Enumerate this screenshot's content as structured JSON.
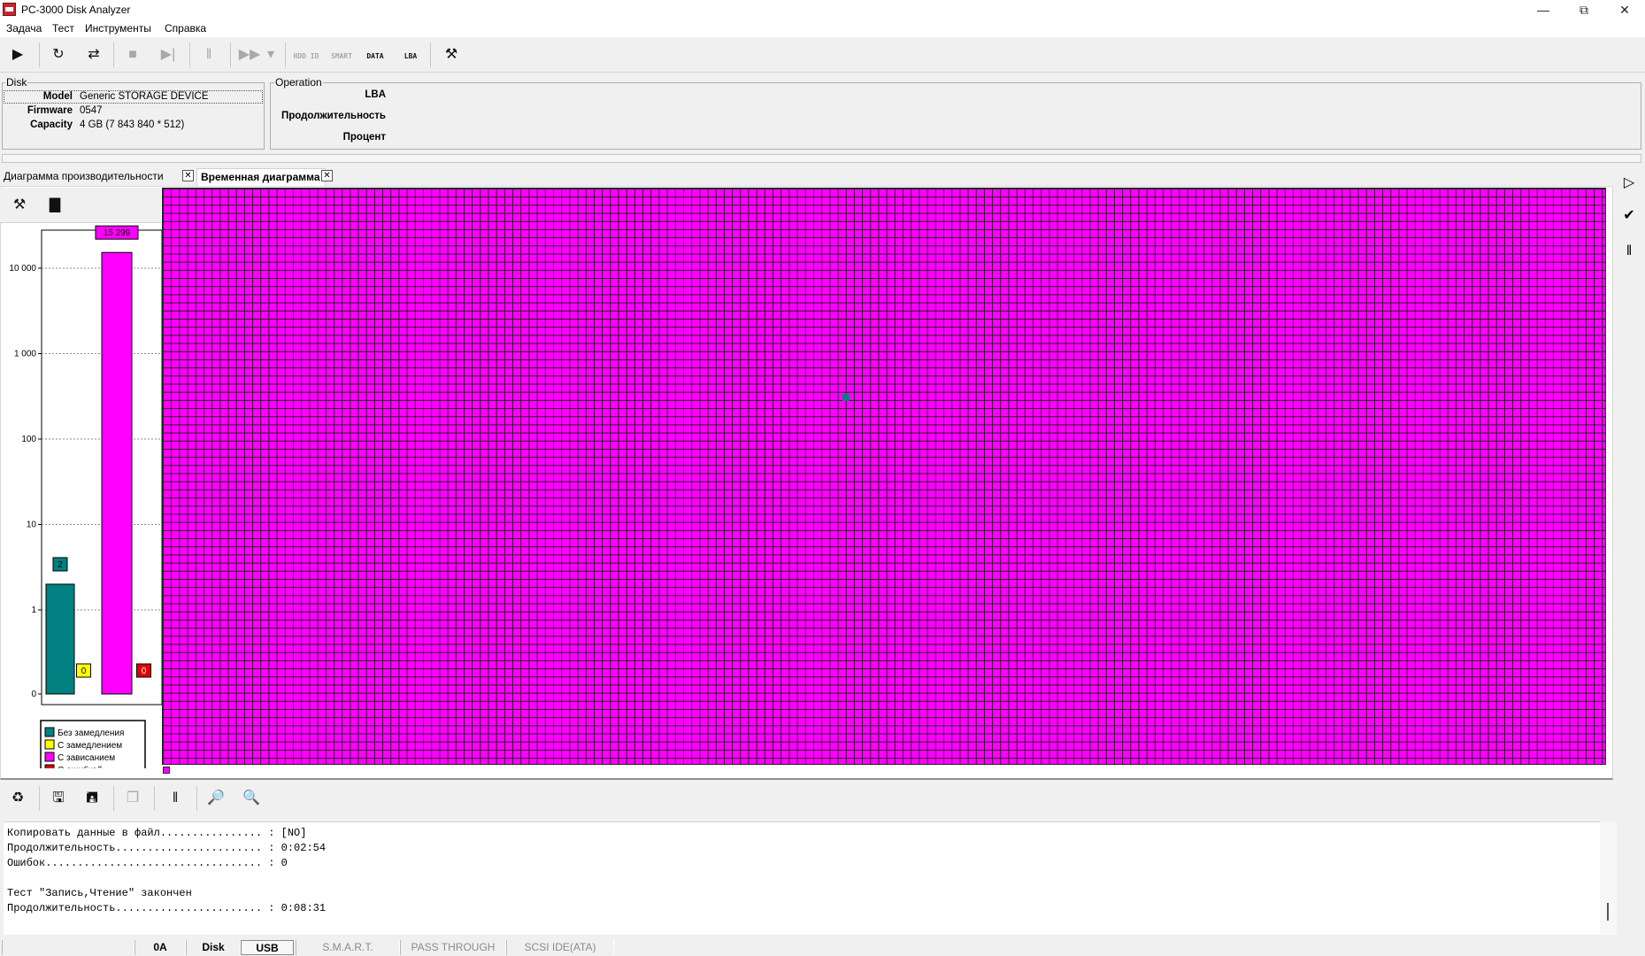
{
  "window": {
    "title": "PC-3000 Disk Analyzer"
  },
  "menu": [
    "Задача",
    "Тест",
    "Инструменты",
    "Справка"
  ],
  "toolbar": {
    "hdd_id_label": "HDD ID",
    "smart_label": "SMART",
    "data_label": "DATA",
    "lba_label": "LBA"
  },
  "disk": {
    "title": "Disk",
    "model_label": "Model",
    "model": "Generic STORAGE DEVICE",
    "firmware_label": "Firmware",
    "firmware": "0547",
    "capacity_label": "Capacity",
    "capacity": "4 GB (7 843 840 * 512)"
  },
  "operation": {
    "title": "Operation",
    "lba_label": "LBA",
    "duration_label": "Продолжительность",
    "percent_label": "Процент"
  },
  "tabs": [
    {
      "label": "Диаграмма производительности"
    },
    {
      "label": "Временная диаграмма"
    }
  ],
  "chart_data": {
    "type": "bar",
    "categories": [
      "Без замедления",
      "С замедлением",
      "С зависанием",
      "С ошибкой"
    ],
    "values": [
      2,
      0,
      15299,
      0
    ],
    "value_labels": [
      "2",
      "0",
      "15 299",
      "0"
    ],
    "colors": [
      "#008080",
      "#ffff00",
      "#ff00ff",
      "#e00000"
    ],
    "y_scale": "log",
    "ytick_labels": [
      "0",
      "1",
      "10",
      "100",
      "1 000",
      "10 000"
    ],
    "legend": [
      "Без замедления",
      "С замедлением",
      "С зависанием",
      "С ошибкой"
    ]
  },
  "colors": {
    "stalled": "#ff00ff",
    "normal": "#008080"
  },
  "log": {
    "lines": [
      "Копировать данные в файл................ : [NO]",
      "Продолжительность....................... : 0:02:54",
      "Ошибок.................................. : 0",
      "",
      "Тест \"Запись,Чтение\" закончен",
      "Продолжительность....................... : 0:08:31"
    ]
  },
  "status": [
    "0A",
    "Disk",
    "USB",
    "S.M.A.R.T.",
    "PASS THROUGH",
    "SCSI IDE(ATA)"
  ]
}
